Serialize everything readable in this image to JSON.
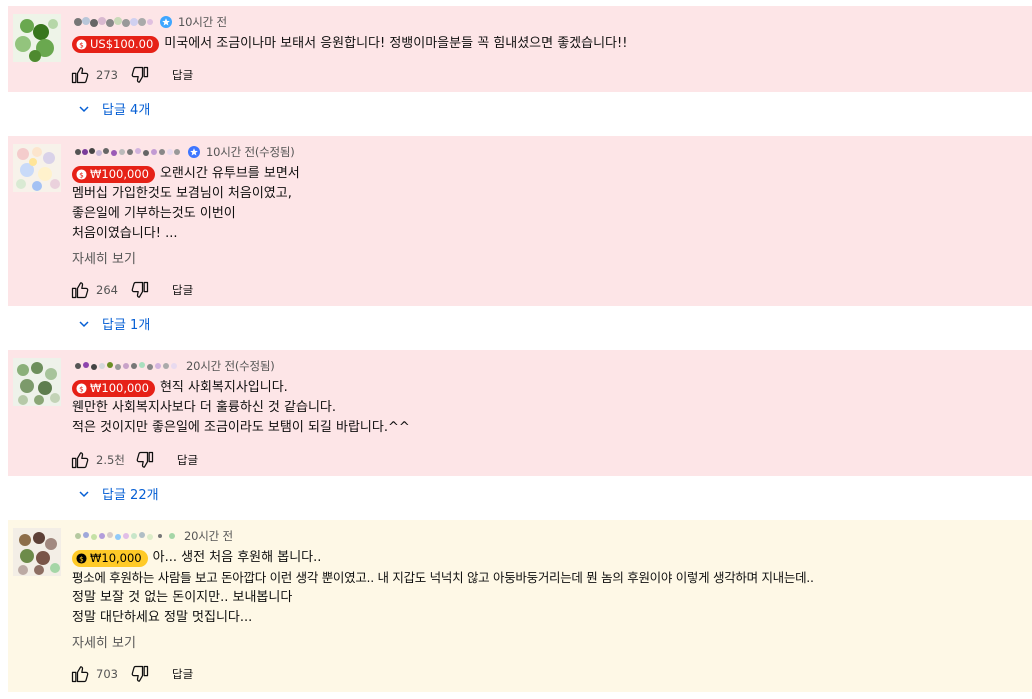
{
  "comments": [
    {
      "time": "10시간 전",
      "verified": true,
      "amount": "US$100.00",
      "chip_color": "#e62117",
      "lines": [
        "미국에서 조금이나마 보태서 응원합니다! 정뱅이마을분들 꼭 힘내셨으면 좋겠습니다!!"
      ],
      "more": "",
      "likes": "273",
      "reply": "답글",
      "replies": "답글 4개"
    },
    {
      "time": "10시간 전(수정됨)",
      "verified": true,
      "amount": "₩100,000",
      "chip_color": "#e62117",
      "lines": [
        "오랜시간 유투브를 보면서",
        "멤버십 가입한것도 보겸님이 처음이였고,",
        "좋은일에 기부하는것도 이번이",
        "처음이였습니다! ..."
      ],
      "more": "자세히 보기",
      "likes": "264",
      "reply": "답글",
      "replies": "답글 1개"
    },
    {
      "time": "20시간 전(수정됨)",
      "verified": false,
      "amount": "₩100,000",
      "chip_color": "#e62117",
      "lines": [
        "현직 사회복지사입니다.",
        "웬만한 사회복지사보다 더 훌륭하신 것 같습니다.",
        "적은 것이지만 좋은일에 조금이라도 보탬이 되길 바랍니다.^^"
      ],
      "more": "",
      "likes": "2.5천",
      "reply": "답글",
      "replies": "답글 22개"
    },
    {
      "time": "20시간 전",
      "verified": false,
      "amount": "₩10,000",
      "chip_color": "#ffca28",
      "lines": [
        "아... 생전 처음 후원해 봅니다..",
        "평소에 후원하는 사람들 보고 돈아깝다 이런 생각 뿐이였고.. 내 지갑도 넉넉치 않고 아둥바둥거리는데 뭔 놈의 후원이야 이렇게 생각하며 지내는데..",
        "정말 보잘 것 없는 돈이지만.. 보내봅니다",
        "정말 대단하세요 정말 멋집니다..."
      ],
      "more": "자세히 보기",
      "likes": "703",
      "reply": "답글",
      "replies": ""
    }
  ]
}
